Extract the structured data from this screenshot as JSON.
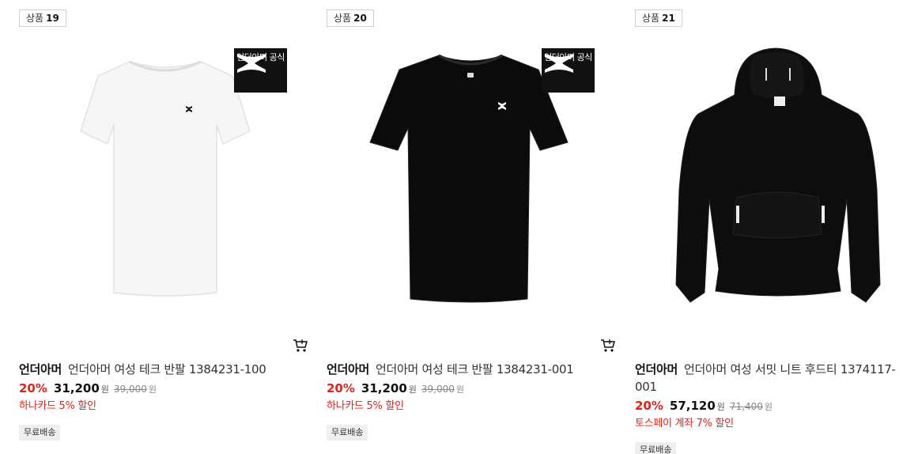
{
  "products": [
    {
      "rank_label": "상품",
      "rank_num": "19",
      "official_label": "언더아머 공식",
      "brand": "언더아머",
      "name": "언더아머 여성 테크 반팔 1384231-100",
      "discount": "20%",
      "price": "31,200",
      "price_unit": "원",
      "original_price": "39,000",
      "original_unit": "원",
      "promo": "하나카드 5% 할인",
      "shipping": "무료배송",
      "image_icon": "white-tshirt",
      "cart_icon": "cart-icon"
    },
    {
      "rank_label": "상품",
      "rank_num": "20",
      "official_label": "언더아머 공식",
      "brand": "언더아머",
      "name": "언더아머 여성 테크 반팔 1384231-001",
      "discount": "20%",
      "price": "31,200",
      "price_unit": "원",
      "original_price": "39,000",
      "original_unit": "원",
      "promo": "하나카드 5% 할인",
      "shipping": "무료배송",
      "image_icon": "black-tshirt",
      "cart_icon": "cart-icon"
    },
    {
      "rank_label": "상품",
      "rank_num": "21",
      "brand": "언더아머",
      "name": "언더아머 여성 서밋 니트 후드티 1374117-001",
      "discount": "20%",
      "price": "57,120",
      "price_unit": "원",
      "original_price": "71,400",
      "original_unit": "원",
      "promo": "토스페이 계좌 7% 할인",
      "shipping": "무료배송",
      "image_icon": "black-hoodie",
      "cart_icon": "cart-icon"
    }
  ],
  "colors": {
    "sale_red": "#e2231a",
    "text_dark": "#111111",
    "badge_bg": "#efefef"
  }
}
